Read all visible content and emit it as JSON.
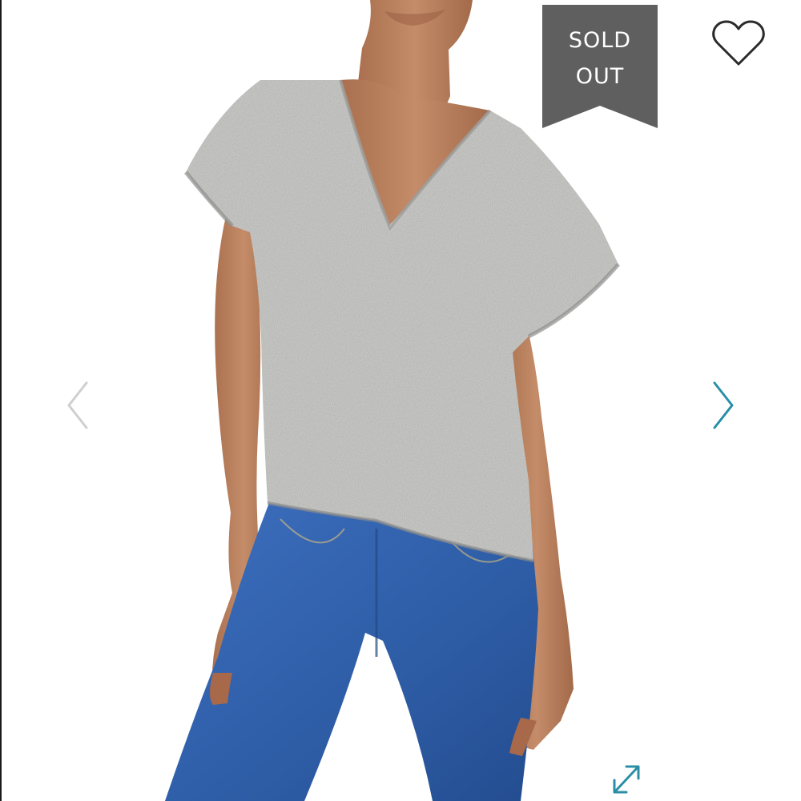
{
  "badge": {
    "line1": "SOLD",
    "line2": "OUT",
    "color": "#5f5f5f"
  },
  "icons": {
    "favorite": "heart-icon",
    "previous": "chevron-left-icon",
    "next": "chevron-right-icon",
    "expand": "expand-icon"
  },
  "colors": {
    "accent": "#2a8fa6",
    "arrow_inactive": "#cfcfcf",
    "heart": "#2b2b2b",
    "sweater": "#b3b3b1",
    "denim": "#2f5ea8",
    "skin": "#b37a58"
  }
}
